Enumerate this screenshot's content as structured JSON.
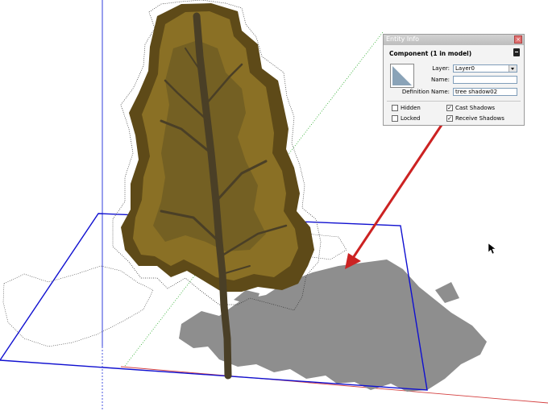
{
  "entity_info": {
    "title": "Entity Info",
    "close_icon": "close-icon",
    "header": "Component (1 in model)",
    "collapse_icon": "minimize-icon",
    "layer_label": "Layer:",
    "layer_value": "Layer0",
    "name_label": "Name:",
    "name_value": "",
    "definition_label": "Definition Name:",
    "definition_value": "tree shadow02",
    "hidden_label": "Hidden",
    "hidden_checked": false,
    "locked_label": "Locked",
    "locked_checked": false,
    "cast_shadows_label": "Cast Shadows",
    "cast_shadows_checked": true,
    "receive_shadows_label": "Receive Shadows",
    "receive_shadows_checked": true,
    "check_mark": "✓"
  },
  "colors": {
    "blue_axis": "#1a2ad8",
    "green_axis": "#22aa22",
    "red_axis": "#d44040",
    "selection_box": "#1010d0",
    "shadow": "#8e8e8e",
    "trunk": "#4a3f26",
    "foliage_dark": "#5e4a18",
    "foliage_light": "#9a7e2a",
    "annotation_arrow": "#cc2222"
  }
}
